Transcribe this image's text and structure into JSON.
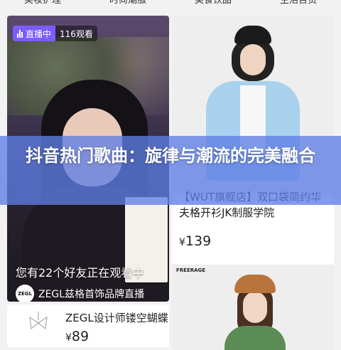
{
  "tabs": [
    "美妆护理",
    "时尚潮服",
    "美食饮品",
    "生活百货"
  ],
  "live_card": {
    "badge_label": "直播中",
    "viewer_count": "116观看",
    "friends_text": "您有22个好友正在观看中",
    "store_logo": "ZEGL",
    "store_name": "ZEGL兹格首饰品牌直播"
  },
  "product_1": {
    "title": "【WUT旗舰店】双口袋简约华夫格开衫JK制服学院",
    "currency": "¥",
    "price": "139"
  },
  "product_2": {
    "brand_logo": "FREERAGE"
  },
  "product_3": {
    "title": "ZEGL设计师镂空蝴蝶",
    "currency": "¥",
    "price": "89"
  },
  "banner": {
    "title": "抖音热门歌曲：旋律与潮流的完美融合"
  },
  "colors": {
    "banner": "#5f7de6",
    "live_badge": "#7b5cff"
  }
}
